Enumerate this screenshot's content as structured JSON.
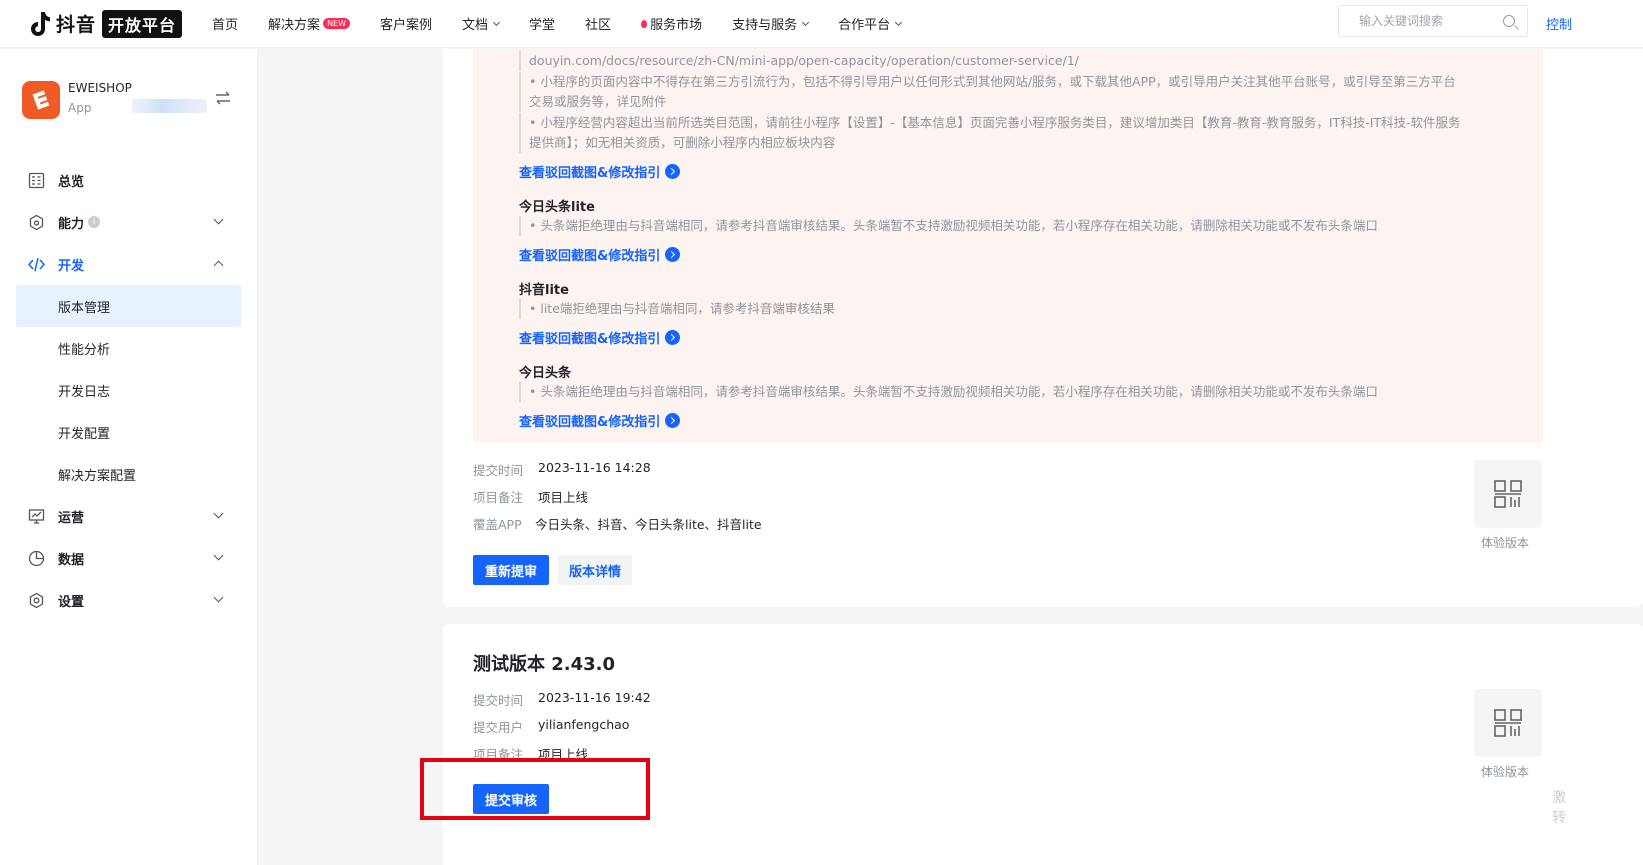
{
  "topnav": {
    "logo_word": "抖音",
    "logo_tag": "开放平台",
    "items": [
      {
        "label": "首页"
      },
      {
        "label": "解决方案",
        "badge": "NEW"
      },
      {
        "label": "客户案例"
      },
      {
        "label": "文档",
        "dropdown": true
      },
      {
        "label": "学堂"
      },
      {
        "label": "社区"
      },
      {
        "label": "服务市场",
        "fire": true
      },
      {
        "label": "支持与服务",
        "dropdown": true
      },
      {
        "label": "合作平台",
        "dropdown": true
      }
    ],
    "search_placeholder": "输入关键词搜索",
    "console": "控制"
  },
  "sidebar": {
    "app_name": "EWEISHOP",
    "app_sub": "App",
    "menu": {
      "overview": "总览",
      "ability": "能力",
      "develop": "开发",
      "version_mgmt": "版本管理",
      "perf": "性能分析",
      "devlog": "开发日志",
      "devconfig": "开发配置",
      "solution_config": "解决方案配置",
      "operate": "运营",
      "data": "数据",
      "settings": "设置"
    }
  },
  "reject": {
    "url_line": "douyin.com/docs/resource/zh-CN/mini-app/open-capacity/operation/customer-service/1/",
    "bullet1_l1": "• 小程序的页面内容中不得存在第三方引流行为，包括不得引导用户以任何形式到其他网站/服务，或下载其他APP，或引导用户关注其他平台账号，或引导至第三方平台",
    "bullet1_l2": "交易或服务等，详见附件",
    "bullet2_l1": "• 小程序经营内容超出当前所选类目范围，请前往小程序【设置】-【基本信息】页面完善小程序服务类目，建议增加类目【教育-教育-教育服务，IT科技-IT科技-软件服务",
    "bullet2_l2": "提供商】；如无相关资质，可删除小程序内相应板块内容",
    "link_text": "查看驳回截图&修改指引",
    "sections": [
      {
        "title": "今日头条lite",
        "reason": "• 头条端拒绝理由与抖音端相同，请参考抖音端审核结果。头条端暂不支持激励视频相关功能，若小程序存在相关功能，请删除相关功能或不发布头条端口"
      },
      {
        "title": "抖音lite",
        "reason": "• lite端拒绝理由与抖音端相同，请参考抖音端审核结果"
      },
      {
        "title": "今日头条",
        "reason": "• 头条端拒绝理由与抖音端相同，请参考抖音端审核结果。头条端暂不支持激励视频相关功能，若小程序存在相关功能，请删除相关功能或不发布头条端口"
      }
    ]
  },
  "audit_version": {
    "submit_time_label": "提交时间",
    "submit_time": "2023-11-16 14:28",
    "remark_label": "项目备注",
    "remark": "项目上线",
    "apps_label": "覆盖APP",
    "apps": "今日头条、抖音、今日头条lite、抖音lite",
    "resubmit_btn": "重新提审",
    "detail_btn": "版本详情",
    "qr_label": "体验版本"
  },
  "test_version": {
    "title": "测试版本 2.43.0",
    "submit_time_label": "提交时间",
    "submit_time": "2023-11-16 19:42",
    "user_label": "提交用户",
    "user": "yilianfengchao",
    "remark_label": "项目备注",
    "remark": "项目上线",
    "submit_btn": "提交审核",
    "qr_label": "体验版本"
  },
  "float_text": "激\n转",
  "colors": {
    "accent": "#1664ff",
    "brand_red": "#fe2c55",
    "highlight": "#e60012",
    "reject_bg": "#fdf3f1"
  }
}
